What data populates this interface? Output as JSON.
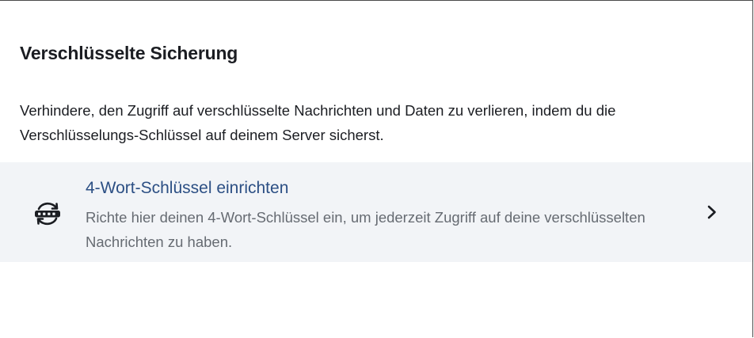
{
  "section": {
    "title": "Verschlüsselte Sicherung",
    "description": "Verhindere, den Zugriff auf verschlüsselte Nachrichten und Daten zu verlieren, indem du die Verschlüsselungs-Schlüssel auf deinem Server sicherst."
  },
  "action": {
    "title": "4-Wort-Schlüssel einrichten",
    "description": "Richte hier deinen 4-Wort-Schlüssel ein, um jederzeit Zugriff auf deine verschlüsselten Nachrichten zu haben.",
    "icon": "key-rotate-icon",
    "chevron_icon": "chevron-right-icon"
  },
  "colors": {
    "title_text": "#1b1d22",
    "action_title": "#2c4f84",
    "action_desc": "#666b72",
    "row_background": "#f2f4f7"
  }
}
